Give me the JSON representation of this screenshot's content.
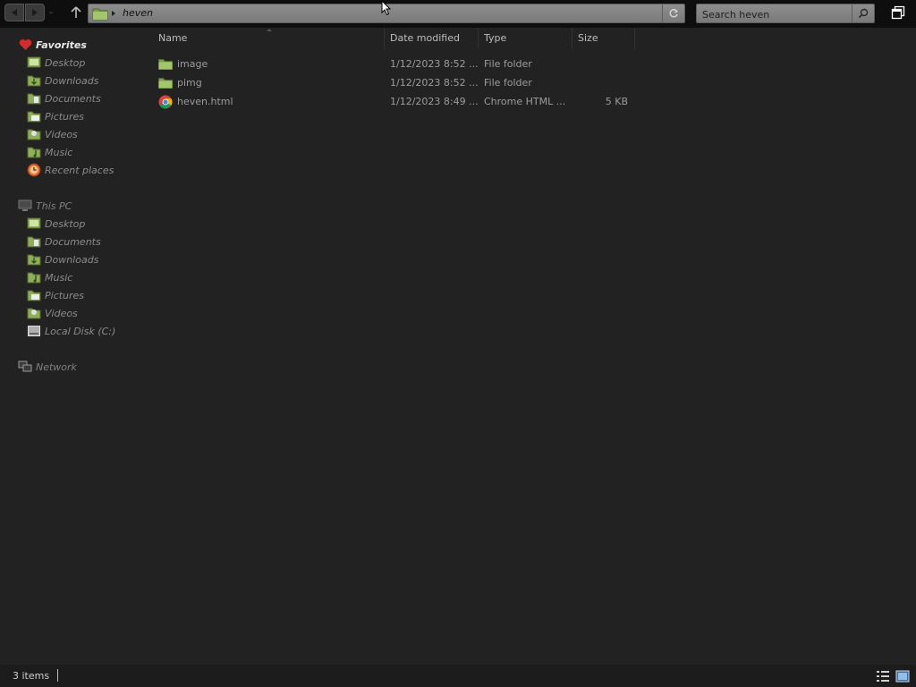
{
  "address_bar": {
    "path": "heven"
  },
  "search": {
    "placeholder": "Search heven"
  },
  "nav": {
    "favorites": {
      "label": "Favorites",
      "items": [
        {
          "label": "Desktop",
          "icon": "desktop-icon"
        },
        {
          "label": "Downloads",
          "icon": "downloads-icon"
        },
        {
          "label": "Documents",
          "icon": "documents-icon"
        },
        {
          "label": "Pictures",
          "icon": "pictures-icon"
        },
        {
          "label": "Videos",
          "icon": "videos-icon"
        },
        {
          "label": "Music",
          "icon": "music-icon"
        },
        {
          "label": "Recent places",
          "icon": "recent-places-icon"
        }
      ]
    },
    "this_pc": {
      "label": "This PC",
      "items": [
        {
          "label": "Desktop",
          "icon": "desktop-icon"
        },
        {
          "label": "Documents",
          "icon": "documents-icon"
        },
        {
          "label": "Downloads",
          "icon": "downloads-icon"
        },
        {
          "label": "Music",
          "icon": "music-icon"
        },
        {
          "label": "Pictures",
          "icon": "pictures-icon"
        },
        {
          "label": "Videos",
          "icon": "videos-icon"
        },
        {
          "label": "Local Disk (C:)",
          "icon": "local-disk-icon"
        }
      ]
    },
    "network": {
      "label": "Network"
    }
  },
  "columns": {
    "name": "Name",
    "date_modified": "Date modified",
    "type": "Type",
    "size": "Size"
  },
  "files": [
    {
      "name": "image",
      "date_modified": "1/12/2023 8:52 ...",
      "type": "File folder",
      "size": "",
      "icon": "folder-icon"
    },
    {
      "name": "pimg",
      "date_modified": "1/12/2023 8:52 ...",
      "type": "File folder",
      "size": "",
      "icon": "folder-icon"
    },
    {
      "name": "heven.html",
      "date_modified": "1/12/2023 8:49 ...",
      "type": "Chrome HTML ...",
      "size": "5 KB",
      "icon": "chrome-icon"
    }
  ],
  "status": {
    "item_count": "3 items"
  },
  "colors": {
    "background": "#222222",
    "topbar": "#0e0e0e",
    "folder": "#8fae5a",
    "favorites_heart": "#d62a2a"
  }
}
